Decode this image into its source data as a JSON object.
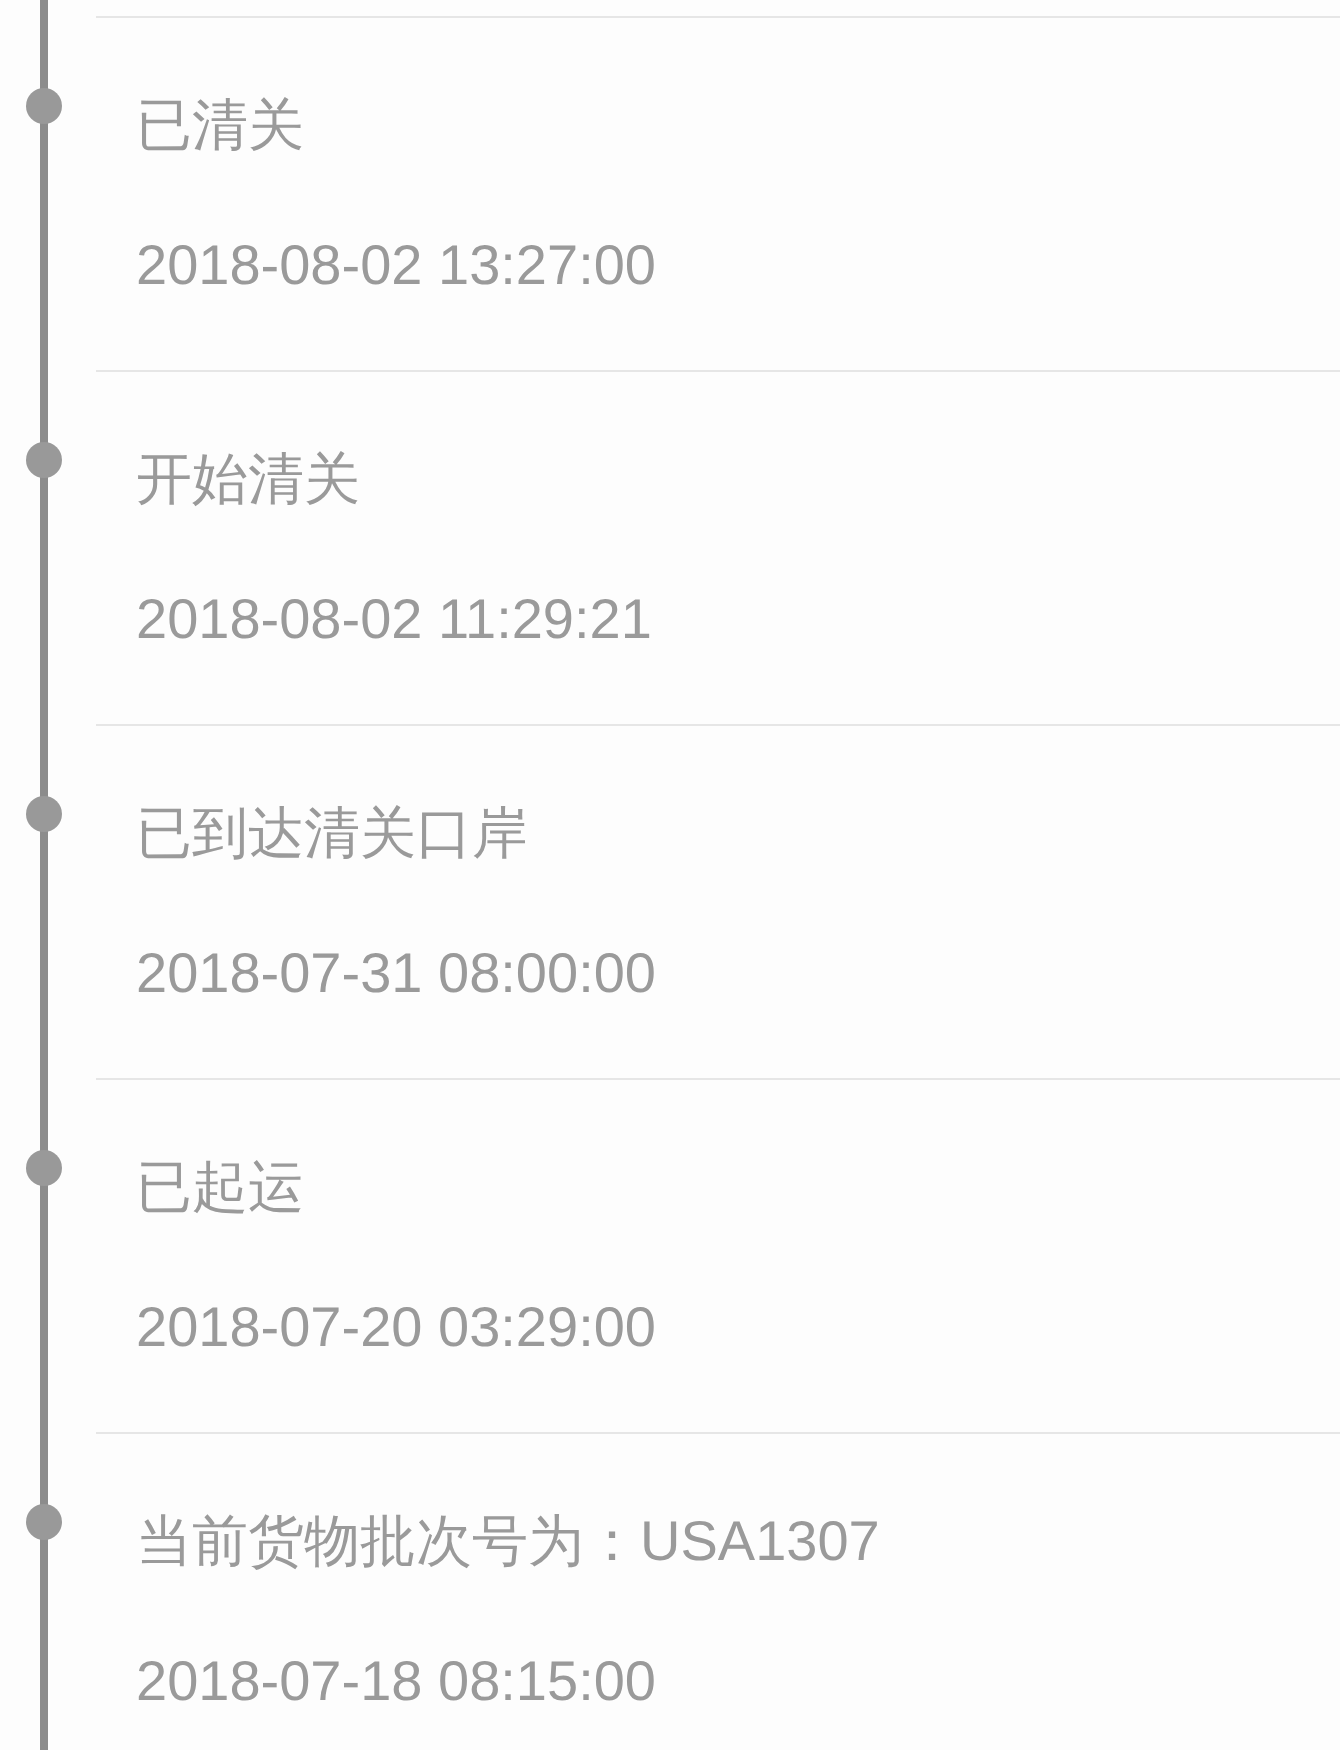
{
  "events": [
    {
      "status": "已清关",
      "time": "2018-08-02 13:27:00"
    },
    {
      "status": "开始清关",
      "time": "2018-08-02 11:29:21"
    },
    {
      "status": "已到达清关口岸",
      "time": "2018-07-31 08:00:00"
    },
    {
      "status": "已起运",
      "time": "2018-07-20 03:29:00"
    },
    {
      "status": "当前货物批次号为：USA1307",
      "time": "2018-07-18 08:15:00"
    }
  ]
}
